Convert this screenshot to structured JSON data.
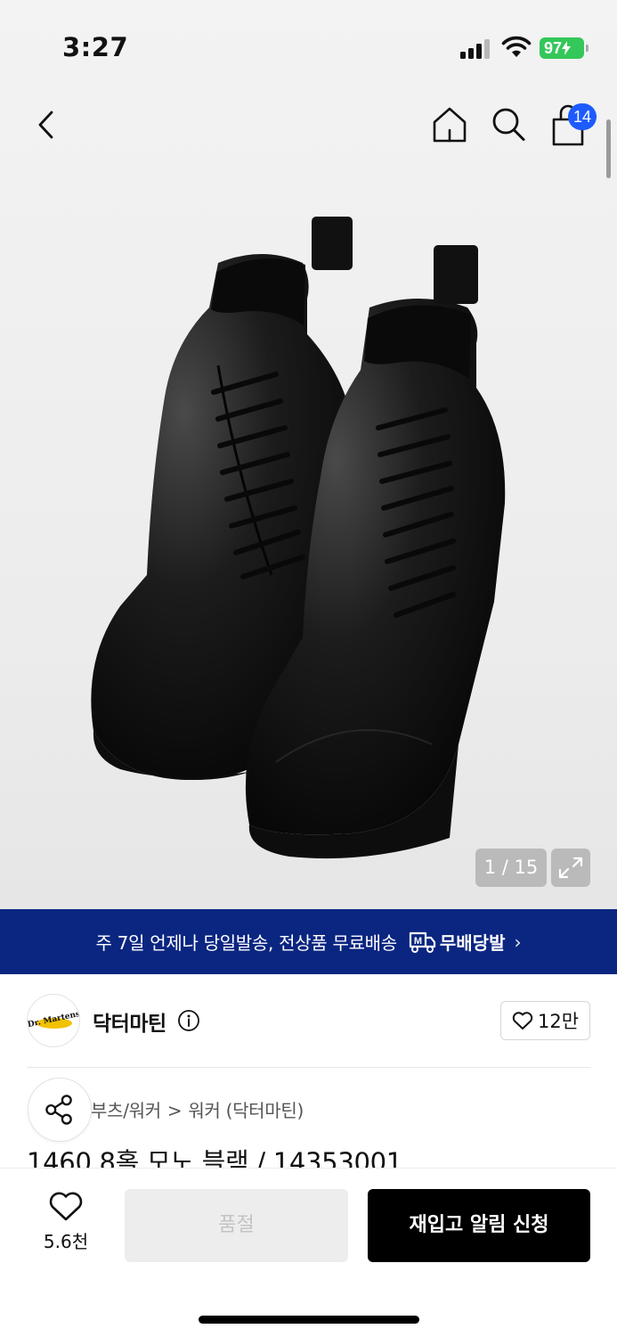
{
  "status_bar": {
    "time": "3:27",
    "battery": "97"
  },
  "nav": {
    "cart_count": "14"
  },
  "gallery": {
    "page_indicator": "1 / 15"
  },
  "banner": {
    "text": "주 7일 언제나 당일발송, 전상품 무료배송",
    "logo_text": "무배당발",
    "logo_icon_letter": "M"
  },
  "brand": {
    "logo_text": "Dr. Martens",
    "name": "닥터마틴",
    "like_count": "12만"
  },
  "breadcrumb": {
    "items": [
      "부츠/워커",
      "워커 (닥터마틴)"
    ],
    "separator": ">"
  },
  "product": {
    "title": "1460 8홀 모노 블랙 / 14353001"
  },
  "bottom_bar": {
    "wish_count": "5.6천",
    "soldout_label": "품절",
    "restock_label": "재입고 알림 신청"
  }
}
